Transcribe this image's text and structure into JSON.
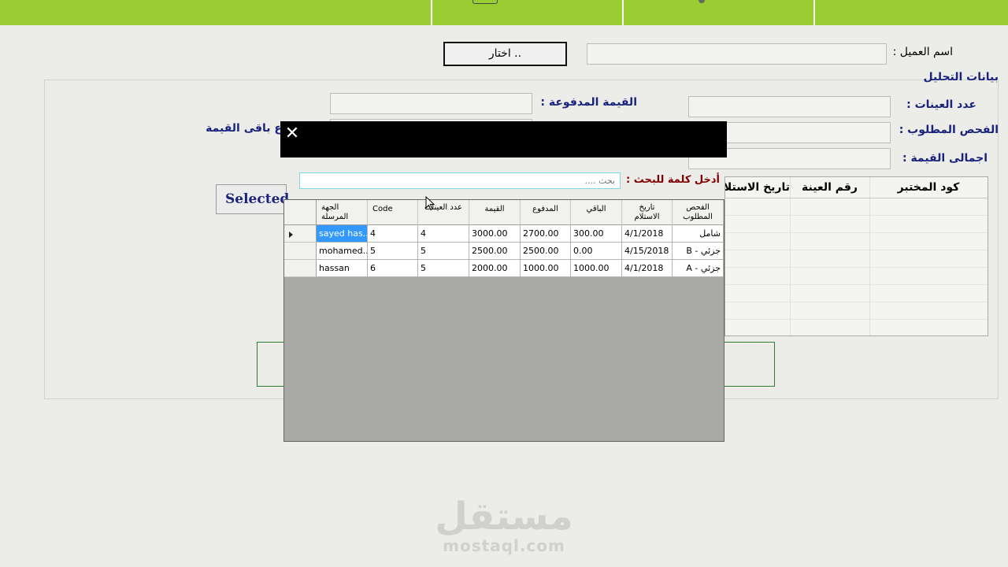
{
  "form": {
    "client_name_label": "اسم العميل :",
    "choose_button": "اختار ..",
    "analysis_section_title": "بيانات التحليل",
    "samples_count_label": "عدد العينات :",
    "required_test_label": "الفحص المطلوب :",
    "total_value_label": "اجمالى القيمة :",
    "paid_value_label": "القيمة المدفوعة :",
    "remaining_label": "ع باقى القيمة",
    "selected_button": "Selected"
  },
  "background_grid": {
    "columns": [
      "كود المختبر",
      "رقم العينة",
      "تاريخ الاستلا"
    ]
  },
  "overlay": {
    "close_glyph": "✕",
    "search_label": "أدخل كلمة للبحث :",
    "search_placeholder": "بحث ....",
    "grid": {
      "columns": [
        "الجهة المرسلة",
        "Code",
        "عدد العينات",
        "القيمة",
        "المدفوع",
        "الباقي",
        "تاريخ الاستلام",
        "الفحص المطلوب"
      ],
      "rows": [
        [
          "sayed has...",
          "4",
          "4",
          "3000.00",
          "2700.00",
          "300.00",
          "4/1/2018",
          "شامل"
        ],
        [
          "mohamed...",
          "5",
          "5",
          "2500.00",
          "2500.00",
          "0.00",
          "4/15/2018",
          "جزئي - B"
        ],
        [
          "hassan",
          "6",
          "5",
          "2000.00",
          "1000.00",
          "1000.00",
          "4/1/2018",
          "جزئي - A"
        ]
      ]
    }
  },
  "watermark": {
    "arabic": "مستقل",
    "latin": "mostaql.com"
  }
}
